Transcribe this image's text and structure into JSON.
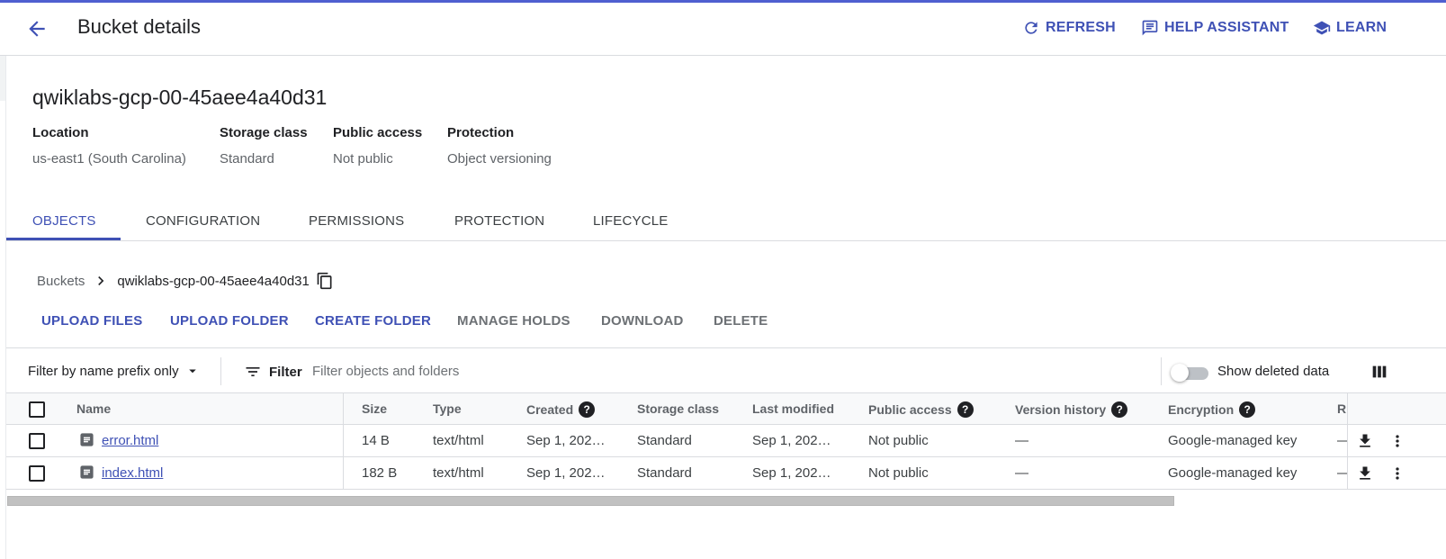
{
  "header": {
    "title": "Bucket details",
    "actions": [
      {
        "label": "REFRESH",
        "icon": "refresh-icon"
      },
      {
        "label": "HELP ASSISTANT",
        "icon": "chat-help-icon"
      },
      {
        "label": "LEARN",
        "icon": "school-icon"
      }
    ]
  },
  "bucket": {
    "name": "qwiklabs-gcp-00-45aee4a40d31",
    "info": [
      {
        "label": "Location",
        "value": "us-east1 (South Carolina)"
      },
      {
        "label": "Storage class",
        "value": "Standard"
      },
      {
        "label": "Public access",
        "value": "Not public"
      },
      {
        "label": "Protection",
        "value": "Object versioning"
      }
    ]
  },
  "tabs": [
    "OBJECTS",
    "CONFIGURATION",
    "PERMISSIONS",
    "PROTECTION",
    "LIFECYCLE"
  ],
  "active_tab": "OBJECTS",
  "breadcrumb": {
    "root": "Buckets",
    "current": "qwiklabs-gcp-00-45aee4a40d31"
  },
  "toolbar": [
    {
      "label": "UPLOAD FILES",
      "enabled": true
    },
    {
      "label": "UPLOAD FOLDER",
      "enabled": true
    },
    {
      "label": "CREATE FOLDER",
      "enabled": true
    },
    {
      "label": "MANAGE HOLDS",
      "enabled": false
    },
    {
      "label": "DOWNLOAD",
      "enabled": false
    },
    {
      "label": "DELETE",
      "enabled": false
    }
  ],
  "filter": {
    "prefix_select": "Filter by name prefix only",
    "filter_label": "Filter",
    "placeholder": "Filter objects and folders",
    "show_deleted_label": "Show deleted data",
    "show_deleted": false
  },
  "table": {
    "columns": [
      "Name",
      "Size",
      "Type",
      "Created",
      "Storage class",
      "Last modified",
      "Public access",
      "Version history",
      "Encryption",
      "R"
    ],
    "help_columns": [
      "Created",
      "Public access",
      "Version history",
      "Encryption"
    ],
    "rows": [
      {
        "name": "error.html",
        "size": "14 B",
        "type": "text/html",
        "created": "Sep 1, 202…",
        "storage_class": "Standard",
        "last_modified": "Sep 1, 202…",
        "public_access": "Not public",
        "version_history": "—",
        "encryption": "Google-managed key",
        "retention": "—"
      },
      {
        "name": "index.html",
        "size": "182 B",
        "type": "text/html",
        "created": "Sep 1, 202…",
        "storage_class": "Standard",
        "last_modified": "Sep 1, 202…",
        "public_access": "Not public",
        "version_history": "—",
        "encryption": "Google-managed key",
        "retention": "—"
      }
    ]
  },
  "colors": {
    "accent": "#3f51b5",
    "text": "#202124",
    "muted": "#5f6368",
    "divider": "#dadce0"
  }
}
